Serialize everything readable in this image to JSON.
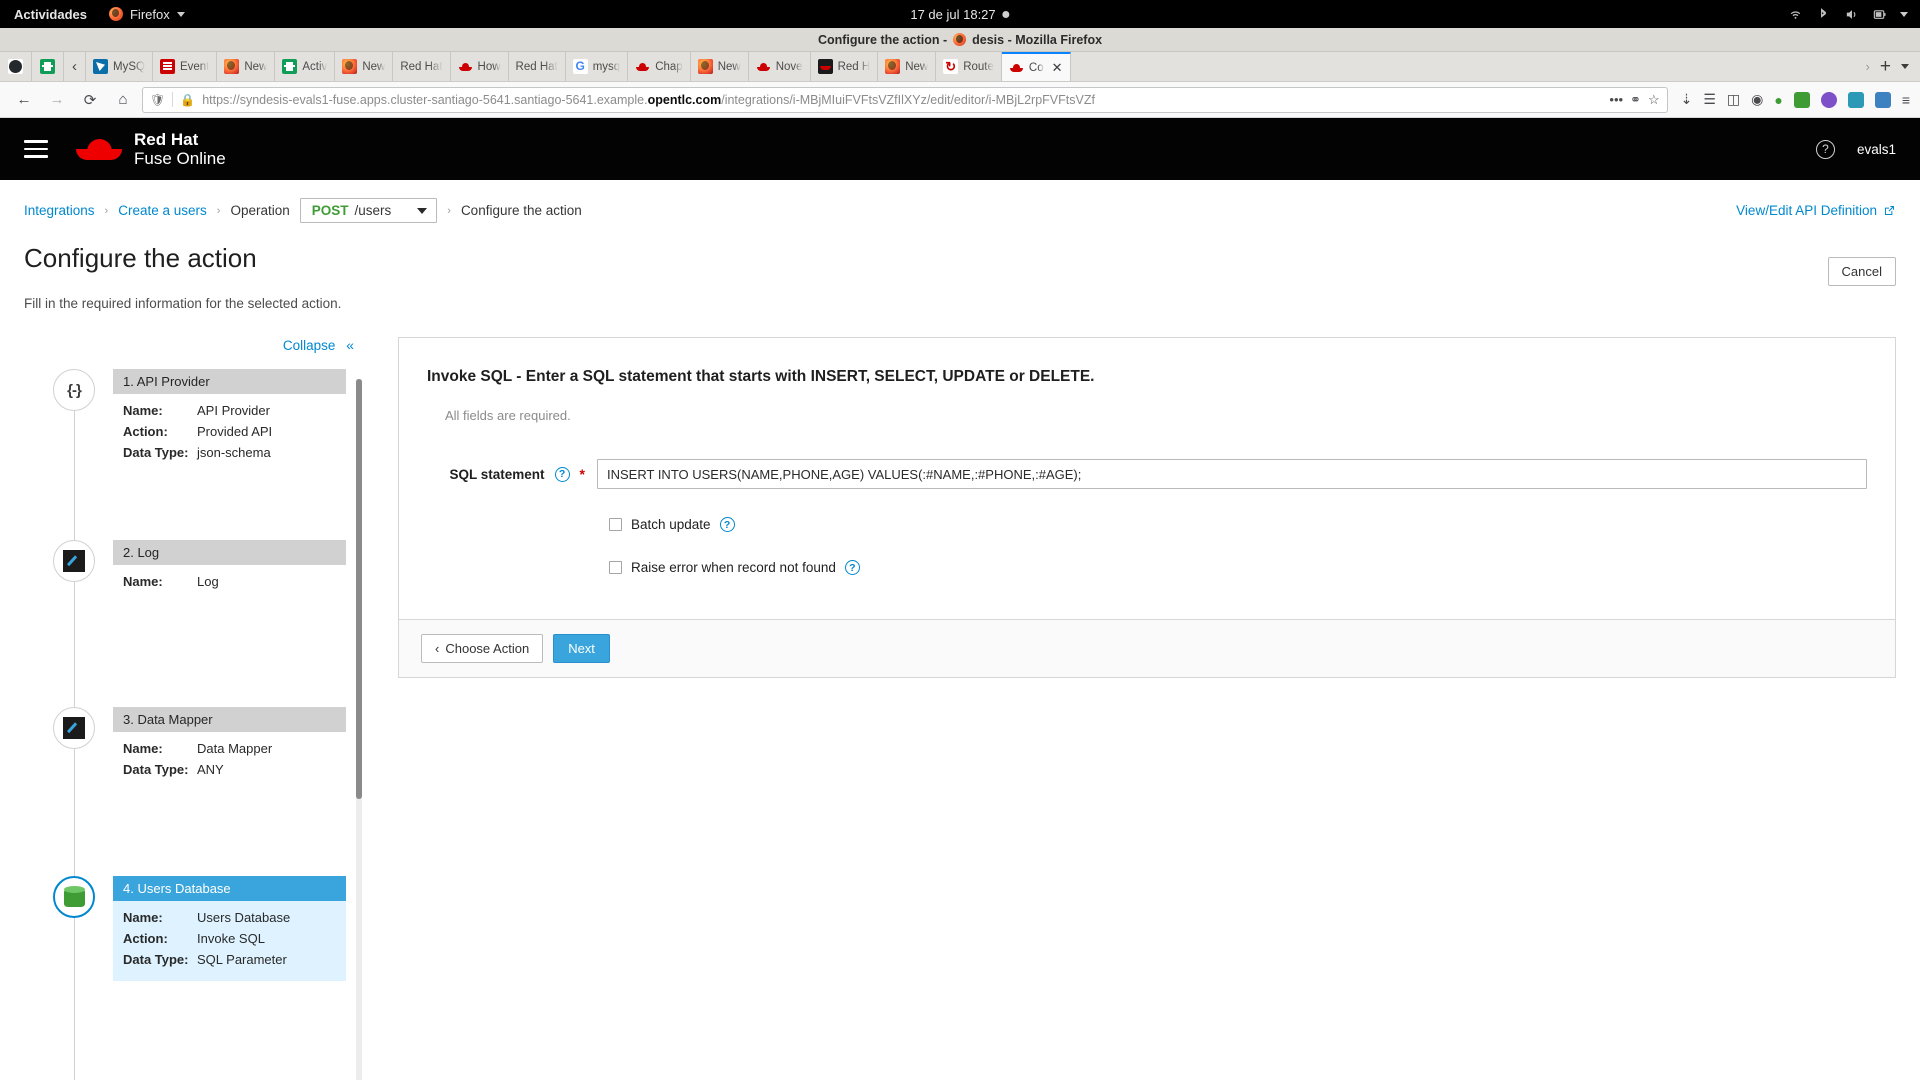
{
  "gnome": {
    "activities": "Actividades",
    "app_menu": "Firefox",
    "clock": "17 de jul  18:27",
    "tray_icons": [
      "wifi-icon",
      "bluetooth-icon",
      "volume-icon",
      "battery-icon",
      "power-chevron-icon"
    ]
  },
  "browser": {
    "window_title": "Configure the action - Syndesis - Mozilla Firefox",
    "window_title_prefix": "Configure the action - ",
    "window_title_suffix": "desis - Mozilla Firefox",
    "url": "https://syndesis-evals1-fuse.apps.cluster-santiago-5641.santiago-5641.example.",
    "url_domain": "opentlc.com",
    "url_path": "/integrations/i-MBjMIuiFVFtsVZfIlXYz/edit/editor/i-MBjL2rpFVFtsVZf",
    "tabs": [
      {
        "label": "",
        "icon": "github-icon",
        "pinned": true,
        "active": false
      },
      {
        "label": "",
        "icon": "sheets-icon",
        "pinned": true,
        "active": false
      },
      {
        "label": "",
        "icon": "chevron-left-icon",
        "pinned": true,
        "active": false
      },
      {
        "label": "MySQ",
        "icon": "mysql-icon",
        "pinned": false,
        "active": false
      },
      {
        "label": "Event",
        "icon": "evernote-icon",
        "pinned": false,
        "active": false
      },
      {
        "label": "New",
        "icon": "firefox-icon",
        "pinned": false,
        "active": false
      },
      {
        "label": "Activ",
        "icon": "sheets-icon",
        "pinned": false,
        "active": false
      },
      {
        "label": "New",
        "icon": "firefox-icon",
        "pinned": false,
        "active": false
      },
      {
        "label": "Red Hat",
        "icon": "generic-icon",
        "pinned": false,
        "active": false
      },
      {
        "label": "How",
        "icon": "redhat-icon",
        "pinned": false,
        "active": false
      },
      {
        "label": "Red Hat",
        "icon": "generic-icon",
        "pinned": false,
        "active": false
      },
      {
        "label": "mysq",
        "icon": "google-icon",
        "pinned": false,
        "active": false
      },
      {
        "label": "Chap",
        "icon": "redhat-icon",
        "pinned": false,
        "active": false
      },
      {
        "label": "New",
        "icon": "firefox-icon",
        "pinned": false,
        "active": false
      },
      {
        "label": "Nove",
        "icon": "redhat-icon",
        "pinned": false,
        "active": false
      },
      {
        "label": "Red H",
        "icon": "redhat-dark-icon",
        "pinned": false,
        "active": false
      },
      {
        "label": "New",
        "icon": "firefox-icon",
        "pinned": false,
        "active": false
      },
      {
        "label": "Route",
        "icon": "openshift-icon",
        "pinned": false,
        "active": false
      },
      {
        "label": "Co",
        "icon": "redhat-icon",
        "pinned": false,
        "active": true
      }
    ],
    "tab_list_chevron": "›",
    "new_tab": "+",
    "tab_menu_chevron": "⌄",
    "nav": {
      "back": "←",
      "forward": "→",
      "reload": "⟳",
      "home": "⌂",
      "page_actions": "•••",
      "pocket": "pocket-icon",
      "bookmark_star": "☆"
    }
  },
  "fuse": {
    "brand_line1": "Red Hat",
    "brand_line2": "Fuse Online",
    "help_label": "?",
    "user": "evals1",
    "breadcrumb": {
      "items": [
        {
          "label": "Integrations",
          "link": true
        },
        {
          "label": "Create a users",
          "link": true
        },
        {
          "label": "Operation",
          "link": false
        }
      ],
      "separator": "›",
      "operation_verb": "POST",
      "operation_path": "/users",
      "final": "Configure the action",
      "api_definition_link": "View/Edit API Definition",
      "api_definition_icon": "external-link-icon"
    },
    "page_title": "Configure the action",
    "page_subtitle": "Fill in the required information for the selected action.",
    "cancel_label": "Cancel",
    "sidebar": {
      "collapse_label": "Collapse",
      "collapse_icon": "«",
      "steps": [
        {
          "head": "1. API Provider",
          "icon": "braces-icon",
          "current": false,
          "fields": [
            {
              "k": "Name:",
              "v": "API Provider"
            },
            {
              "k": "Action:",
              "v": "Provided API"
            },
            {
              "k": "Data Type:",
              "v": "json-schema"
            }
          ]
        },
        {
          "head": "2. Log",
          "icon": "log-icon",
          "current": false,
          "fields": [
            {
              "k": "Name:",
              "v": "Log"
            }
          ]
        },
        {
          "head": "3. Data Mapper",
          "icon": "mapper-icon",
          "current": false,
          "fields": [
            {
              "k": "Name:",
              "v": "Data Mapper"
            },
            {
              "k": "Data Type:",
              "v": "ANY"
            }
          ]
        },
        {
          "head": "4. Users Database",
          "icon": "database-icon",
          "current": true,
          "fields": [
            {
              "k": "Name:",
              "v": "Users Database"
            },
            {
              "k": "Action:",
              "v": "Invoke SQL"
            },
            {
              "k": "Data Type:",
              "v": "SQL Parameter"
            }
          ]
        }
      ]
    },
    "form": {
      "title": "Invoke SQL - Enter a SQL statement that starts with INSERT, SELECT, UPDATE or DELETE.",
      "note": "All fields are required.",
      "sql_label": "SQL statement",
      "sql_help_icon": "question-icon",
      "sql_required_mark": "*",
      "sql_value": "INSERT INTO USERS(NAME,PHONE,AGE) VALUES(:#NAME,:#PHONE,:#AGE);",
      "batch_label": "Batch update",
      "batch_checked": false,
      "raise_label": "Raise error when record not found",
      "raise_checked": false,
      "back_label": "Choose Action",
      "back_icon": "‹",
      "next_label": "Next"
    }
  },
  "colors": {
    "accent": "#0088ce",
    "primary_button": "#39a5dc",
    "redhat_red": "#ee0000",
    "green": "#3f9c35",
    "required_red": "#cc0000",
    "step_head": "#d1d1d1",
    "step_current_bg": "#def3ff"
  }
}
